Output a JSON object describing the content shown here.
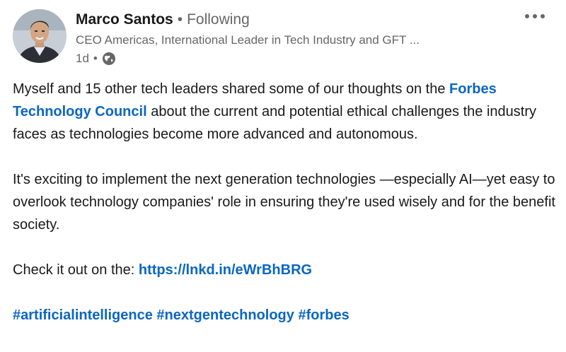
{
  "author": {
    "name": "Marco Santos",
    "separator": "•",
    "follow_state": "Following",
    "headline": "CEO Americas, International Leader in Tech Industry and GFT ...",
    "time": "1d",
    "visibility_icon": "globe-icon"
  },
  "menu": {
    "icon": "more-options-icon"
  },
  "post": {
    "p1_before": "Myself and 15 other tech leaders shared some of our thoughts on the ",
    "p1_mention": "Forbes Technology Council",
    "p1_after": " about the current and potential ethical challenges the industry faces as technologies become more advanced and autonomous.",
    "p2": "It's exciting to implement the next generation technologies —especially AI—yet easy to overlook technology companies' role in ensuring they're used wisely and for the benefit society.",
    "p3_prefix": "Check it out on the: ",
    "p3_link": "https://lnkd.in/eWrBhBRG",
    "hashtags": [
      "#artificialintelligence",
      "#nextgentechnology",
      "#forbes"
    ]
  },
  "colors": {
    "link": "#0a66c2",
    "text": "#191919",
    "muted": "#666666"
  }
}
